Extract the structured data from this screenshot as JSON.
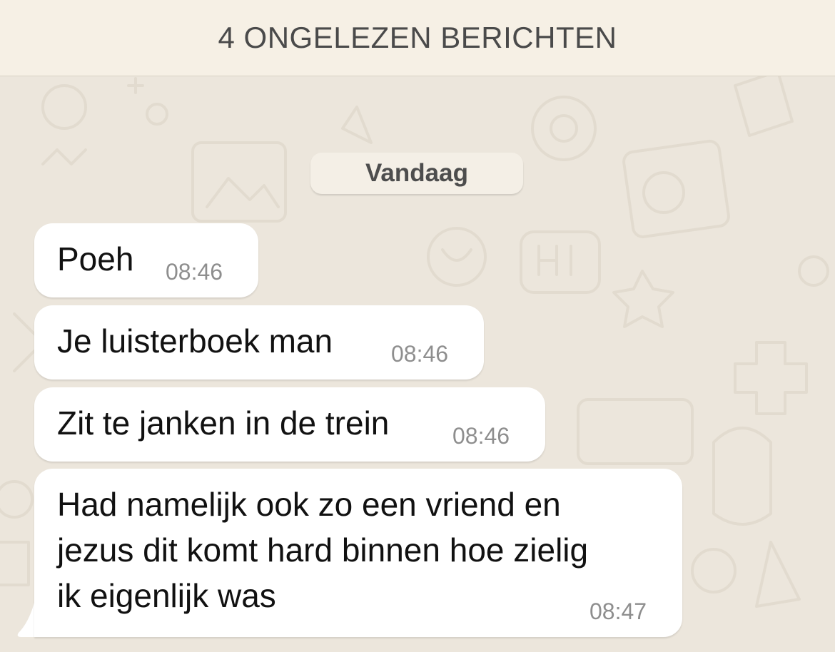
{
  "banner": {
    "unread_text": "4 ONGELEZEN BERICHTEN"
  },
  "date_chip": {
    "label": "Vandaag"
  },
  "messages": [
    {
      "lines": [
        "Poeh"
      ],
      "time": "08:46"
    },
    {
      "lines": [
        "Je luisterboek man"
      ],
      "time": "08:46"
    },
    {
      "lines": [
        "Zit te janken in de trein"
      ],
      "time": "08:46"
    },
    {
      "lines": [
        "Had namelijk ook zo een vriend en",
        "jezus dit komt hard binnen hoe zielig",
        "ik eigenlijk was"
      ],
      "time": "08:47"
    }
  ],
  "colors": {
    "chat_background": "#ece6dc",
    "banner_background": "#f6f0e5",
    "bubble_background": "#ffffff",
    "timestamp": "#8e8e8e",
    "text": "#111111"
  }
}
